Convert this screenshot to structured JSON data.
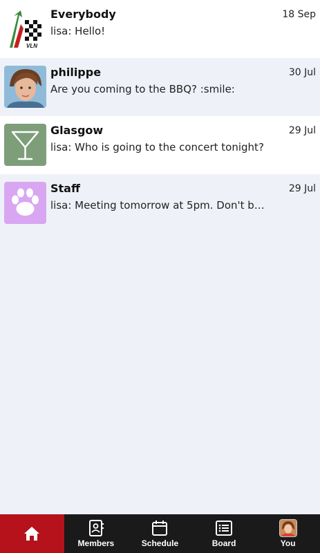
{
  "conversations": [
    {
      "name": "Everybody",
      "date": "18 Sep",
      "message": "lisa: Hello!",
      "avatar": "vln-logo",
      "logo_text": "VLN"
    },
    {
      "name": "philippe",
      "date": "30 Jul",
      "message": "Are you coming to the BBQ? :smile:",
      "avatar": "person-photo"
    },
    {
      "name": "Glasgow",
      "date": "29 Jul",
      "message": "lisa: Who is going to the concert tonight?",
      "avatar": "cocktail-icon",
      "color": "#7e9e7a"
    },
    {
      "name": "Staff",
      "date": "29 Jul",
      "message": "lisa: Meeting tomorrow at 5pm. Don't b…",
      "avatar": "paw-icon",
      "color": "#d9a6f2"
    }
  ],
  "nav": {
    "members": "Members",
    "schedule": "Schedule",
    "board": "Board",
    "you": "You",
    "active": "home",
    "accent": "#b5121b"
  }
}
